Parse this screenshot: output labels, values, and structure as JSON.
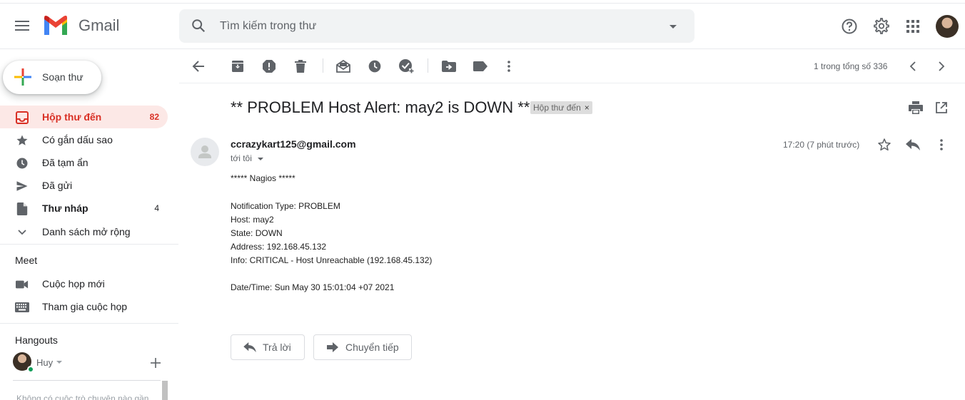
{
  "app": {
    "name": "Gmail"
  },
  "search": {
    "placeholder": "Tìm kiếm trong thư"
  },
  "sidebar": {
    "compose_label": "Soạn thư",
    "items": [
      {
        "label": "Hộp thư đến",
        "count": "82",
        "icon": "inbox-icon"
      },
      {
        "label": "Có gắn dấu sao",
        "count": "",
        "icon": "star-icon"
      },
      {
        "label": "Đã tạm ẩn",
        "count": "",
        "icon": "clock-icon"
      },
      {
        "label": "Đã gửi",
        "count": "",
        "icon": "send-icon"
      },
      {
        "label": "Thư nháp",
        "count": "4",
        "icon": "draft-icon"
      },
      {
        "label": "Danh sách mở rộng",
        "count": "",
        "icon": "chevron-down-icon"
      }
    ],
    "meet": {
      "title": "Meet",
      "items": [
        {
          "label": "Cuộc họp mới",
          "icon": "video-icon"
        },
        {
          "label": "Tham gia cuộc họp",
          "icon": "keyboard-icon"
        }
      ]
    },
    "hangouts": {
      "title": "Hangouts",
      "user": "Huy",
      "note": "Không có cuộc trò chuyện nào gần"
    }
  },
  "toolbar": {
    "pager": "1 trong tổng số 336"
  },
  "message": {
    "subject": "** PROBLEM Host Alert: may2 is DOWN **",
    "label": "Hộp thư đến",
    "label_remove": "×",
    "sender": "ccrazykart125@gmail.com",
    "to": "tới tôi",
    "time": "17:20 (7 phút trước)",
    "body": [
      "***** Nagios *****",
      "Notification Type: PROBLEM",
      "Host: may2",
      "State: DOWN",
      "Address: 192.168.45.132",
      "Info: CRITICAL - Host Unreachable (192.168.45.132)",
      "Date/Time: Sun May 30 15:01:04 +07 2021"
    ],
    "reply_label": "Trả lời",
    "forward_label": "Chuyển tiếp"
  },
  "colors": {
    "accent": "#d93025",
    "active_bg": "#fce8e6",
    "icon": "#5f6368"
  }
}
